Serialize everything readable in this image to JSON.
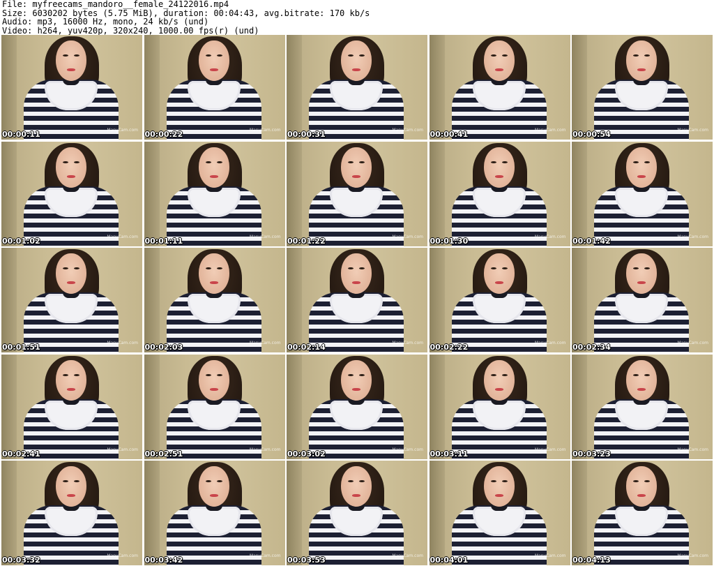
{
  "header": {
    "file": "File: myfreecams_mandoro__female_24122016.mp4",
    "size": "Size: 6030202 bytes (5.75 MiB), duration: 00:04:43, avg.bitrate: 170 kb/s",
    "audio": "Audio: mp3, 16000 Hz, mono, 24 kb/s (und)",
    "video": "Video: h264, yuv420p, 320x240, 1000.00 fps(r) (und)"
  },
  "watermark": "ManyCam.com",
  "thumbnails": [
    {
      "timestamp": "00:00:11"
    },
    {
      "timestamp": "00:00:22"
    },
    {
      "timestamp": "00:00:31"
    },
    {
      "timestamp": "00:00:41"
    },
    {
      "timestamp": "00:00:54"
    },
    {
      "timestamp": "00:01:02"
    },
    {
      "timestamp": "00:01:11"
    },
    {
      "timestamp": "00:01:22"
    },
    {
      "timestamp": "00:01:30"
    },
    {
      "timestamp": "00:01:42"
    },
    {
      "timestamp": "00:01:51"
    },
    {
      "timestamp": "00:02:03"
    },
    {
      "timestamp": "00:02:14"
    },
    {
      "timestamp": "00:02:22"
    },
    {
      "timestamp": "00:02:34"
    },
    {
      "timestamp": "00:02:41"
    },
    {
      "timestamp": "00:02:51"
    },
    {
      "timestamp": "00:03:02"
    },
    {
      "timestamp": "00:03:11"
    },
    {
      "timestamp": "00:03:23"
    },
    {
      "timestamp": "00:03:32"
    },
    {
      "timestamp": "00:03:42"
    },
    {
      "timestamp": "00:03:53"
    },
    {
      "timestamp": "00:04:01"
    },
    {
      "timestamp": "00:04:13"
    }
  ]
}
